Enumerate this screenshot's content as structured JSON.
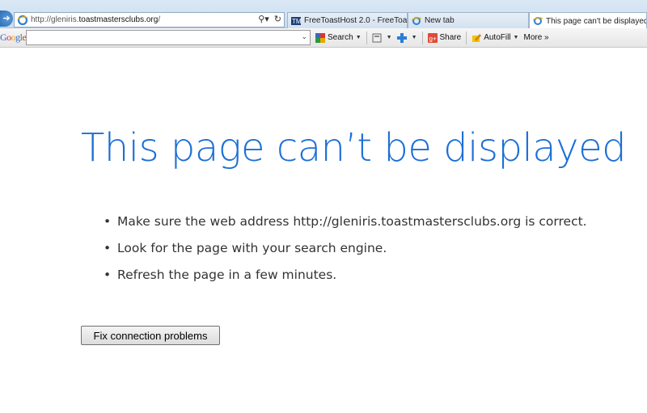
{
  "address_bar": {
    "url_prefix": "http://gleniris.",
    "url_domain": "toastmastersclubs.org",
    "url_suffix": "/",
    "search_icon": "magnifier-icon",
    "refresh_icon": "refresh-icon"
  },
  "tabs": [
    {
      "label": "FreeToastHost 2.0 - FreeToast...",
      "icon": "freetoasthost-icon",
      "active": false
    },
    {
      "label": "New tab",
      "icon": "ie-icon",
      "active": false
    },
    {
      "label": "This page can't be displayed",
      "icon": "ie-icon",
      "active": true
    }
  ],
  "tab_close_glyph": "×",
  "google_toolbar": {
    "logo": {
      "b": "G",
      "r1": "o",
      "y": "o",
      "b2": "g",
      "g": "l",
      "r2": "e"
    },
    "search_value": "",
    "search_label": "Search",
    "share_label": "Share",
    "autofill_label": "AutoFill",
    "more_label": "More »"
  },
  "content": {
    "title": "This page can’t be displayed",
    "tips": [
      "Make sure the web address http://gleniris.toastmastersclubs.org is correct.",
      "Look for the page with your search engine.",
      "Refresh the page in a few minutes."
    ],
    "fix_button_label": "Fix connection problems"
  },
  "colors": {
    "title": "#1c6fd6",
    "chrome": "#c9dcef"
  }
}
